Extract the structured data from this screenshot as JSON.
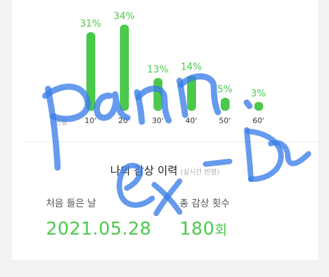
{
  "colors": {
    "accent": "#4cc94c",
    "scribble": "#3a7ee8",
    "background": "#f2f2f4",
    "card": "#ffffff"
  },
  "age_chart": {
    "axis_label": "연령",
    "columns": [
      {
        "tick": "10'",
        "percent": 31,
        "label": "31%"
      },
      {
        "tick": "20'",
        "percent": 34,
        "label": "34%"
      },
      {
        "tick": "30'",
        "percent": 13,
        "label": "13%"
      },
      {
        "tick": "40'",
        "percent": 14,
        "label": "14%"
      },
      {
        "tick": "50'",
        "percent": 5,
        "label": "5%"
      },
      {
        "tick": "60'",
        "percent": 3,
        "label": "3%"
      }
    ]
  },
  "chart_data": {
    "type": "bar",
    "categories": [
      "10'",
      "20'",
      "30'",
      "40'",
      "50'",
      "60'"
    ],
    "values": [
      31,
      34,
      13,
      14,
      5,
      3
    ],
    "xlabel": "연령",
    "ylim": [
      0,
      34
    ]
  },
  "history": {
    "title": "나의 감상 이력",
    "subtitle": "(실시간 반영)",
    "first_listen_label": "처음 들은 날",
    "first_listen_value": "2021.05.28",
    "total_count_label": "총 감상 횟수",
    "total_count_value": "180",
    "total_count_unit": "회"
  },
  "scribble": {
    "line1": "pann.",
    "line2": "ex-D"
  }
}
